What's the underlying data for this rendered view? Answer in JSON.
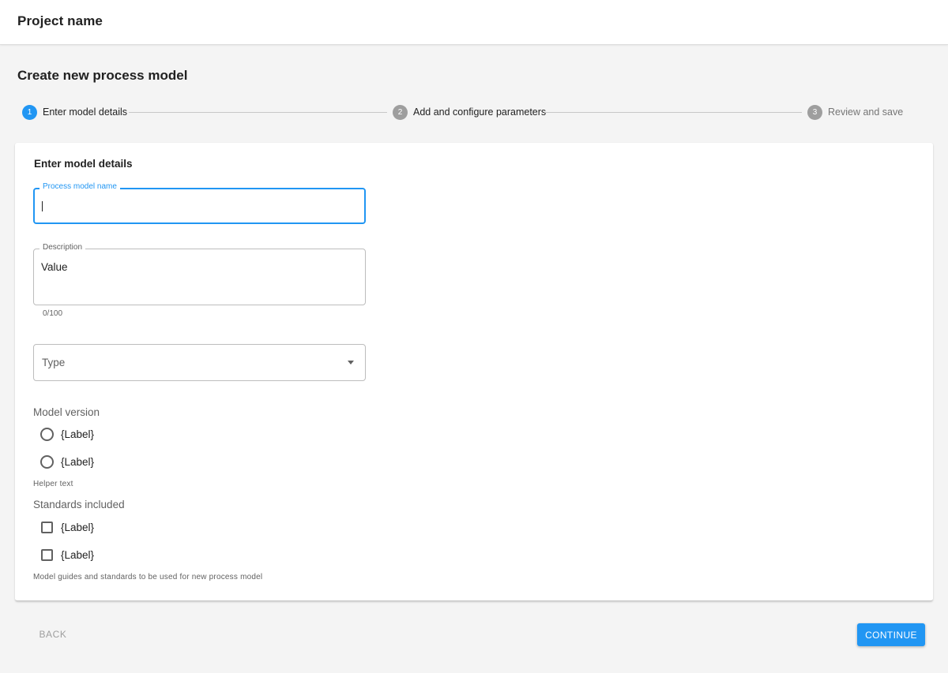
{
  "header": {
    "project_name": "Project name"
  },
  "page": {
    "title": "Create new process model"
  },
  "stepper": {
    "steps": [
      {
        "number": "1",
        "label": "Enter model details"
      },
      {
        "number": "2",
        "label": "Add and configure parameters"
      },
      {
        "number": "3",
        "label": "Review and save"
      }
    ]
  },
  "form": {
    "section_title": "Enter model details",
    "name_field": {
      "label": "Process model name",
      "value": ""
    },
    "description_field": {
      "label": "Description",
      "value": "Value",
      "counter": "0/100"
    },
    "type_select": {
      "placeholder": "Type"
    },
    "model_version": {
      "title": "Model version",
      "options": [
        "{Label}",
        "{Label}"
      ],
      "helper": "Helper text"
    },
    "standards": {
      "title": "Standards included",
      "options": [
        "{Label}",
        "{Label}"
      ],
      "helper": "Model guides and standards to be used for new process model"
    }
  },
  "actions": {
    "back_label": "BACK",
    "continue_label": "CONTINUE"
  },
  "colors": {
    "accent": "#2196f3",
    "inactive_step": "#9e9e9e"
  }
}
